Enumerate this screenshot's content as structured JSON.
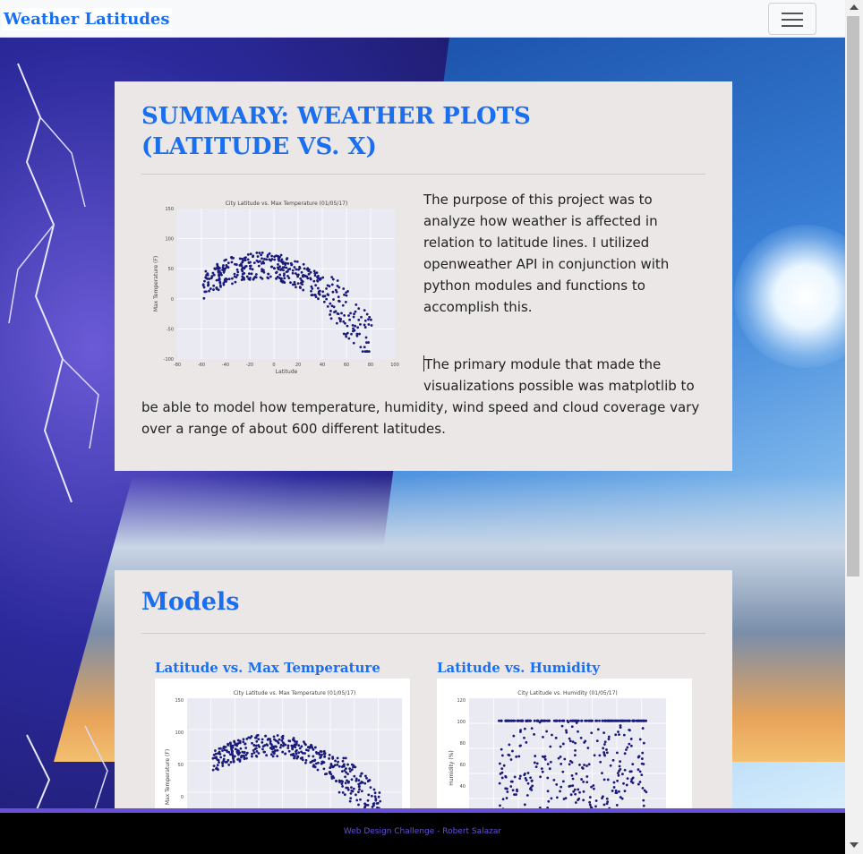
{
  "navbar": {
    "brand": "Weather Latitudes",
    "toggler_icon": "hamburger-icon"
  },
  "summary": {
    "title_line1": "SUMMARY: WEATHER PLOTS",
    "title_line2": "(LATITUDE VS. X)",
    "paragraph1": "The purpose of this project was to analyze how weather is affected in relation to latitude lines. I utilized openweather API in conjunction with python modules and functions to accomplish this.",
    "paragraph2": "The primary module that made the visualizations possible was matplotlib to be able to model how temperature, humidity, wind speed and cloud coverage vary over a range of about 600 different latitudes.",
    "plot": {
      "title": "City Latitude vs. Max Temperature (01/05/17)",
      "xlabel": "Latitude",
      "ylabel": "Max Temperature (F)",
      "xticks": [
        "-80",
        "-60",
        "-40",
        "-20",
        "0",
        "20",
        "40",
        "60",
        "80",
        "100"
      ],
      "yticks": [
        "150",
        "100",
        "50",
        "0",
        "-50",
        "-100"
      ]
    }
  },
  "models": {
    "title": "Models",
    "items": [
      {
        "label": "Latitude vs. Max Temperature",
        "plot_title": "City Latitude vs. Max Temperature (01/05/17)",
        "ylabel": "Max Temperature (F)",
        "yticks": [
          "150",
          "100",
          "50",
          "0"
        ]
      },
      {
        "label": "Latitude vs. Humidity",
        "plot_title": "City Latitude vs. Humidity (01/05/17)",
        "ylabel": "Humidity (%)",
        "yticks": [
          "120",
          "100",
          "80",
          "60",
          "40"
        ]
      }
    ]
  },
  "footer": {
    "text": "Web Design Challenge - Robert Salazar"
  },
  "colors": {
    "accent": "#1a6ff0",
    "panel": "#ebe7e7",
    "footer_accent": "#6a4fd8",
    "points": "#1a1a7a"
  }
}
